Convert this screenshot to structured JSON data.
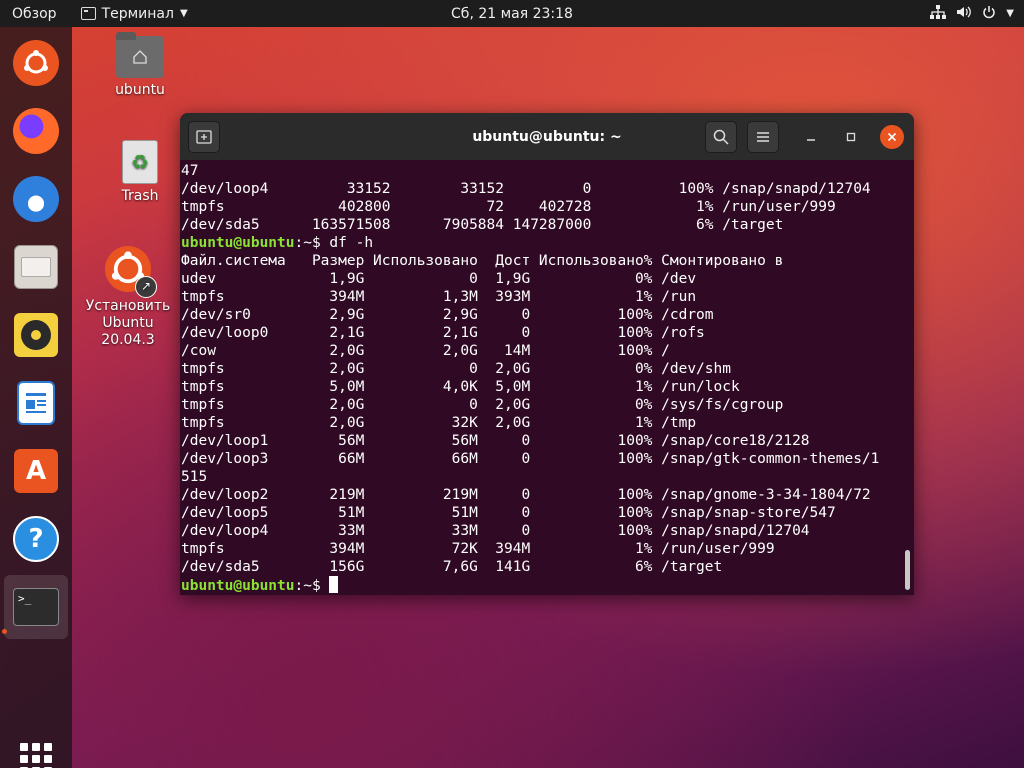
{
  "topbar": {
    "activities": "Обзор",
    "app_name": "Терминал",
    "clock": "Сб, 21 мая  23:18",
    "icons": [
      "network-icon",
      "volume-icon",
      "power-icon",
      "chevron-down-icon"
    ]
  },
  "dock": {
    "items": [
      "ubuntu-installer",
      "firefox",
      "thunderbird",
      "files",
      "rhythmbox",
      "libreoffice-writer",
      "software",
      "help",
      "terminal"
    ],
    "show_apps": "show-apps-grid"
  },
  "desktop": {
    "home_label": "ubuntu",
    "trash_label": "Trash",
    "install_label_1": "Установить",
    "install_label_2": "Ubuntu 20.04.3"
  },
  "terminal": {
    "title": "ubuntu@ubuntu: ~",
    "prompt_user": "ubuntu@ubuntu",
    "prompt_sep": ":~$",
    "lines": [
      {
        "text": "47"
      },
      {
        "text": "/dev/loop4         33152        33152         0          100% /snap/snapd/12704"
      },
      {
        "text": "tmpfs             402800           72    402728            1% /run/user/999"
      },
      {
        "text": "/dev/sda5      163571508      7905884 147287000            6% /target"
      },
      {
        "prompt": true,
        "cmd": " df -h"
      },
      {
        "text": "Файл.система   Размер Использовано  Дост Использовано% Смонтировано в"
      },
      {
        "text": "udev             1,9G            0  1,9G            0% /dev"
      },
      {
        "text": "tmpfs            394M         1,3M  393M            1% /run"
      },
      {
        "text": "/dev/sr0         2,9G         2,9G     0          100% /cdrom"
      },
      {
        "text": "/dev/loop0       2,1G         2,1G     0          100% /rofs"
      },
      {
        "text": "/cow             2,0G         2,0G   14M          100% /"
      },
      {
        "text": "tmpfs            2,0G            0  2,0G            0% /dev/shm"
      },
      {
        "text": "tmpfs            5,0M         4,0K  5,0M            1% /run/lock"
      },
      {
        "text": "tmpfs            2,0G            0  2,0G            0% /sys/fs/cgroup"
      },
      {
        "text": "tmpfs            2,0G          32K  2,0G            1% /tmp"
      },
      {
        "text": "/dev/loop1        56M          56M     0          100% /snap/core18/2128"
      },
      {
        "text": "/dev/loop3        66M          66M     0          100% /snap/gtk-common-themes/1"
      },
      {
        "text": "515"
      },
      {
        "text": "/dev/loop2       219M         219M     0          100% /snap/gnome-3-34-1804/72"
      },
      {
        "text": "/dev/loop5        51M          51M     0          100% /snap/snap-store/547"
      },
      {
        "text": "/dev/loop4        33M          33M     0          100% /snap/snapd/12704"
      },
      {
        "text": "tmpfs            394M          72K  394M            1% /run/user/999"
      },
      {
        "text": "/dev/sda5        156G         7,6G  141G            6% /target"
      },
      {
        "prompt": true,
        "cmd": " ",
        "cursor": true
      }
    ]
  }
}
